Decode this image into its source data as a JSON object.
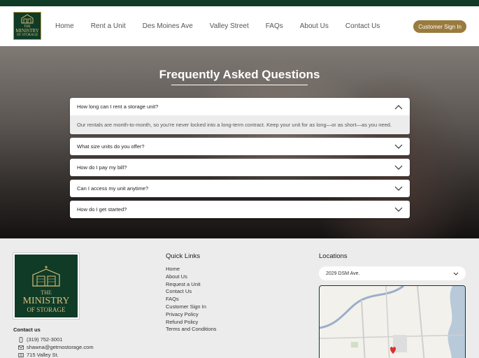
{
  "brand": {
    "logo_the": "THE",
    "logo_word": "MINISTRY",
    "logo_sub": "OF STORAGE"
  },
  "nav": {
    "links": [
      "Home",
      "Rent a Unit",
      "Des Moines Ave",
      "Valley Street",
      "FAQs",
      "About Us",
      "Contact Us"
    ],
    "signin_label": "Customer Sign In"
  },
  "hero": {
    "title": "Frequently Asked Questions"
  },
  "faq": {
    "items": [
      {
        "q": "How long can I rent a storage unit?",
        "a": "Our rentals are month-to-month, so you're never locked into a long-term contract. Keep your unit for as long—or as short—as you need.",
        "expanded": true
      },
      {
        "q": "What size units do you offer?",
        "expanded": false
      },
      {
        "q": "How do I pay my bill?",
        "expanded": false
      },
      {
        "q": "Can I access my unit anytime?",
        "expanded": false
      },
      {
        "q": "How do I get started?",
        "expanded": false
      }
    ]
  },
  "footer": {
    "contact_title": "Contact us",
    "phone": "(319) 752-3001",
    "email": "shawna@getmostorage.com",
    "address": "715 Valley St.",
    "quick_links_title": "Quick Links",
    "quick_links": [
      "Home",
      "About Us",
      "Request a Unit",
      "Contact Us",
      "FAQs",
      "Customer Sign In",
      "Privacy Policy",
      "Refund Policy",
      "Terms and Conditions"
    ],
    "locations_title": "Locations",
    "location_selected": "2029 DSM Ave."
  },
  "colors": {
    "brand_green": "#0f3b27",
    "brand_gold": "#9a7b3e",
    "map_pin": "#d9302c"
  }
}
